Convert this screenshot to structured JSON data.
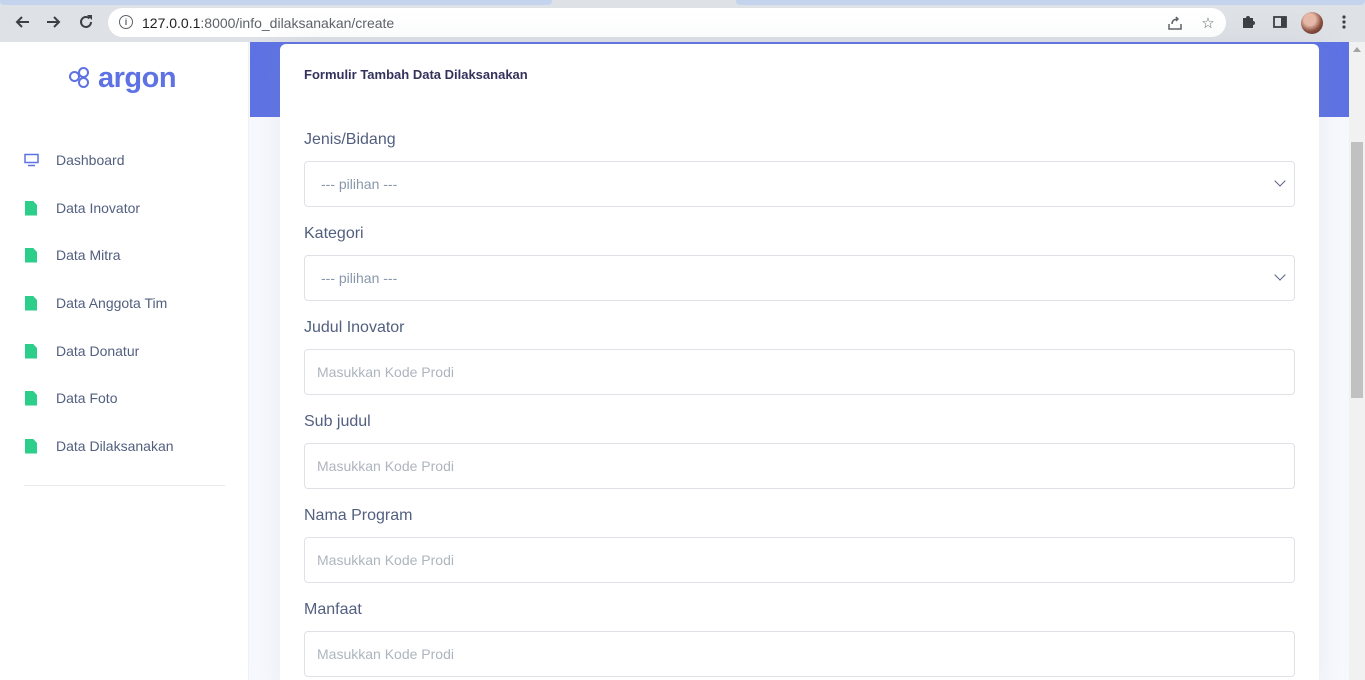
{
  "browser": {
    "url_host": "127.0.0.1",
    "url_path": ":8000/info_dilaksanakan/create"
  },
  "sidebar": {
    "logo_text": "argon",
    "items": [
      {
        "label": "Dashboard",
        "icon": "monitor-icon"
      },
      {
        "label": "Data Inovator",
        "icon": "file-icon"
      },
      {
        "label": "Data Mitra",
        "icon": "file-icon"
      },
      {
        "label": "Data Anggota Tim",
        "icon": "file-icon"
      },
      {
        "label": "Data Donatur",
        "icon": "file-icon"
      },
      {
        "label": "Data Foto",
        "icon": "file-icon"
      },
      {
        "label": "Data Dilaksanakan",
        "icon": "file-icon"
      }
    ]
  },
  "form": {
    "title": "Formulir Tambah Data Dilaksanakan",
    "fields": [
      {
        "label": "Jenis/Bidang",
        "type": "select",
        "value": "--- pilihan ---"
      },
      {
        "label": "Kategori",
        "type": "select",
        "value": "--- pilihan ---"
      },
      {
        "label": "Judul Inovator",
        "type": "input",
        "placeholder": "Masukkan Kode Prodi"
      },
      {
        "label": "Sub judul",
        "type": "input",
        "placeholder": "Masukkan Kode Prodi"
      },
      {
        "label": "Nama Program",
        "type": "input",
        "placeholder": "Masukkan Kode Prodi"
      },
      {
        "label": "Manfaat",
        "type": "input",
        "placeholder": "Masukkan Kode Prodi"
      }
    ]
  },
  "colors": {
    "primary": "#5e72e4",
    "success": "#2dce89",
    "text": "#525f7f",
    "heading": "#32325d"
  }
}
